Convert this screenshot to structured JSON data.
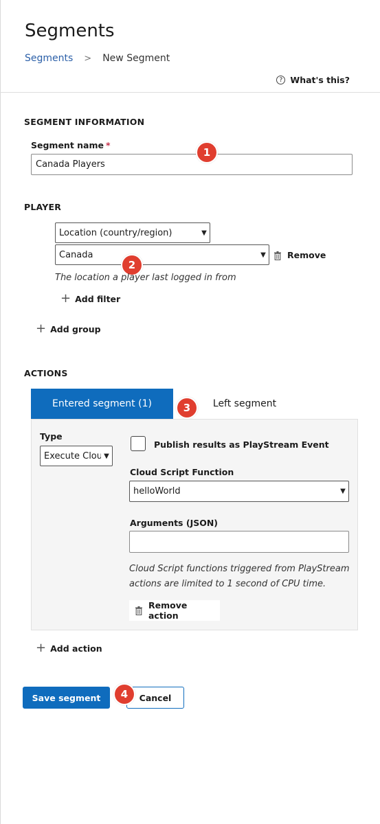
{
  "header": {
    "title": "Segments",
    "breadcrumb": {
      "link": "Segments",
      "separator": ">",
      "current": "New Segment"
    },
    "help_label": "What's this?",
    "help_icon": "question-circle-icon"
  },
  "segment_info": {
    "heading": "SEGMENT INFORMATION",
    "name_label": "Segment name",
    "required_mark": "*",
    "name_value": "Canada Players"
  },
  "player": {
    "heading": "PLAYER",
    "filter_type": "Location (country/region)",
    "filter_value": "Canada",
    "remove_label": "Remove",
    "helper_text": "The location a player last logged in from",
    "add_filter_label": "Add filter",
    "add_group_label": "Add group"
  },
  "actions": {
    "heading": "ACTIONS",
    "tabs": [
      {
        "label": "Entered segment (1)",
        "active": true
      },
      {
        "label": "Left segment",
        "active": false
      }
    ],
    "type_label": "Type",
    "type_value": "Execute Cloud Script",
    "publish_label": "Publish results as PlayStream Event",
    "function_label": "Cloud Script Function",
    "function_value": "helloWorld",
    "arguments_label": "Arguments (JSON)",
    "arguments_value": "",
    "note_line1": "Cloud Script functions triggered from PlayStream",
    "note_line2": "actions are limited to 1 second of CPU time.",
    "remove_action_label": "Remove action",
    "add_action_label": "Add action"
  },
  "footer": {
    "save_label": "Save segment",
    "cancel_label": "Cancel"
  },
  "markers": [
    "1",
    "2",
    "3",
    "4"
  ],
  "colors": {
    "primary": "#0f6cbd",
    "marker": "#e03e2f",
    "link": "#2b5fa8",
    "required": "#c4314b"
  }
}
